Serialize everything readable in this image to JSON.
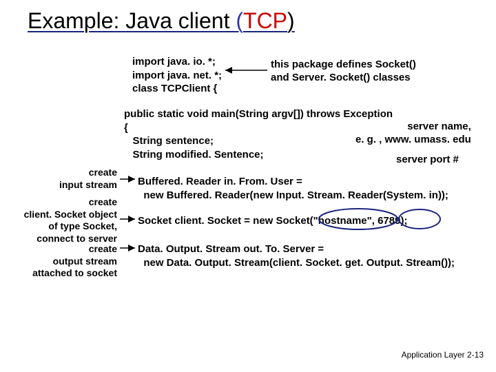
{
  "title_parts": {
    "prefix": "Example: Java client ",
    "open": "(",
    "tcp": "TCP",
    "close": ")"
  },
  "code": {
    "imports": "import java. io. *;\nimport java. net. *;\nclass TCPClient {",
    "main_open": "public static void main(String argv[]) throws Exception\n{\n   String sentence;\n   String modified. Sentence;",
    "bufread": "Buffered. Reader in. From. User =\n  new Buffered. Reader(new Input. Stream. Reader(System. in));",
    "socket": "Socket client. Socket = new Socket(\"hostname\", 6789);",
    "dataout": "Data. Output. Stream out. To. Server =\n  new Data. Output. Stream(client. Socket. get. Output. Stream());"
  },
  "annotations": {
    "import_note_l1": "this package defines Socket()",
    "import_note_l2": "and Server. Socket() classes",
    "server_name_l1": "server name,",
    "server_name_l2": "e. g. , www. umass. edu",
    "server_port": "server port #",
    "left1_l1": "create",
    "left1_l2": "input stream",
    "left2_l1": "create",
    "left2_l2": "client. Socket object",
    "left2_l3": "of type Socket,",
    "left2_l4": "connect to server",
    "left3_l1": "create",
    "left3_l2": "output stream",
    "left3_l3": "attached to socket"
  },
  "footer": {
    "label": "Application Layer",
    "pageno": "2-13"
  }
}
